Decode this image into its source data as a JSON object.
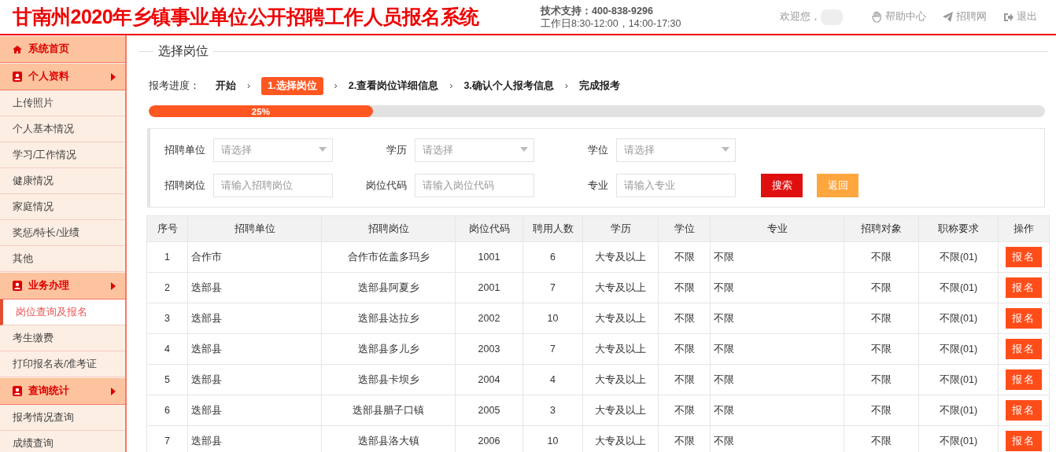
{
  "header": {
    "title": "甘南州2020年乡镇事业单位公开招聘工作人员报名系统",
    "support": "技术支持：400-838-9296",
    "hours": "工作日8:30-12:00，14:00-17:30",
    "welcome": "欢迎您，",
    "links": [
      {
        "kind": "help",
        "label": "帮助中心"
      },
      {
        "kind": "site",
        "label": "招聘网"
      },
      {
        "kind": "logout",
        "label": "退出"
      }
    ]
  },
  "sidebar": {
    "sections": [
      {
        "kind": "home",
        "label": "系统首页",
        "arrow": false
      },
      {
        "kind": "user",
        "label": "个人资料",
        "arrow": true,
        "children": [
          {
            "label": "上传照片",
            "selected": false
          },
          {
            "label": "个人基本情况",
            "selected": false
          },
          {
            "label": "学习/工作情况",
            "selected": false
          },
          {
            "label": "健康情况",
            "selected": false
          },
          {
            "label": "家庭情况",
            "selected": false
          },
          {
            "label": "奖惩/特长/业绩",
            "selected": false
          },
          {
            "label": "其他",
            "selected": false
          }
        ]
      },
      {
        "kind": "user",
        "label": "业务办理",
        "arrow": true,
        "children": [
          {
            "label": "岗位查询及报名",
            "selected": true
          },
          {
            "label": "考生缴费",
            "selected": false
          },
          {
            "label": "打印报名表/准考证",
            "selected": false
          }
        ]
      },
      {
        "kind": "user",
        "label": "查询统计",
        "arrow": true,
        "children": [
          {
            "label": "报考情况查询",
            "selected": false
          },
          {
            "label": "成绩查询",
            "selected": false
          }
        ]
      }
    ]
  },
  "main": {
    "title": "选择岗位",
    "progress_label": "报考进度：",
    "steps": [
      {
        "label": "开始",
        "selected": false
      },
      {
        "label": "1.选择岗位",
        "selected": true
      },
      {
        "label": "2.查看岗位详细信息",
        "selected": false
      },
      {
        "label": "3.确认个人报考信息",
        "selected": false
      },
      {
        "label": "完成报考",
        "selected": false
      }
    ],
    "step_separator": "›",
    "progress": {
      "level": 0.25,
      "reading": "25%"
    },
    "filters": [
      {
        "kind": "select",
        "label": "招聘单位",
        "placeholder": "请选择"
      },
      {
        "kind": "select",
        "label": "学历",
        "placeholder": "请选择"
      },
      {
        "kind": "select",
        "label": "学位",
        "placeholder": "请选择"
      },
      {
        "kind": "input",
        "label": "招聘岗位",
        "placeholder": "请输入招聘岗位"
      },
      {
        "kind": "input",
        "label": "岗位代码",
        "placeholder": "请输入岗位代码"
      },
      {
        "kind": "input",
        "label": "专业",
        "placeholder": "请输入专业"
      }
    ],
    "buttons": [
      {
        "kind": "search",
        "label": "搜索"
      },
      {
        "kind": "back",
        "label": "返回"
      }
    ],
    "table": {
      "columns": [
        "序号",
        "招聘单位",
        "招聘岗位",
        "岗位代码",
        "聘用人数",
        "学历",
        "学位",
        "专业",
        "招聘对象",
        "职称要求",
        "操作"
      ],
      "rows": [
        {
          "cells": [
            "1",
            "合作市",
            "合作市佐盖多玛乡",
            "1001",
            "6",
            "大专及以上",
            "不限",
            "不限",
            "不限",
            "不限(01)"
          ],
          "action": "报名"
        },
        {
          "cells": [
            "2",
            "迭部县",
            "迭部县阿夏乡",
            "2001",
            "7",
            "大专及以上",
            "不限",
            "不限",
            "不限",
            "不限(01)"
          ],
          "action": "报名"
        },
        {
          "cells": [
            "3",
            "迭部县",
            "迭部县达拉乡",
            "2002",
            "10",
            "大专及以上",
            "不限",
            "不限",
            "不限",
            "不限(01)"
          ],
          "action": "报名"
        },
        {
          "cells": [
            "4",
            "迭部县",
            "迭部县多儿乡",
            "2003",
            "7",
            "大专及以上",
            "不限",
            "不限",
            "不限",
            "不限(01)"
          ],
          "action": "报名"
        },
        {
          "cells": [
            "5",
            "迭部县",
            "迭部县卡坝乡",
            "2004",
            "4",
            "大专及以上",
            "不限",
            "不限",
            "不限",
            "不限(01)"
          ],
          "action": "报名"
        },
        {
          "cells": [
            "6",
            "迭部县",
            "迭部县腊子口镇",
            "2005",
            "3",
            "大专及以上",
            "不限",
            "不限",
            "不限",
            "不限(01)"
          ],
          "action": "报名"
        },
        {
          "cells": [
            "7",
            "迭部县",
            "迭部县洛大镇",
            "2006",
            "10",
            "大专及以上",
            "不限",
            "不限",
            "不限",
            "不限(01)"
          ],
          "action": "报名"
        }
      ]
    }
  }
}
